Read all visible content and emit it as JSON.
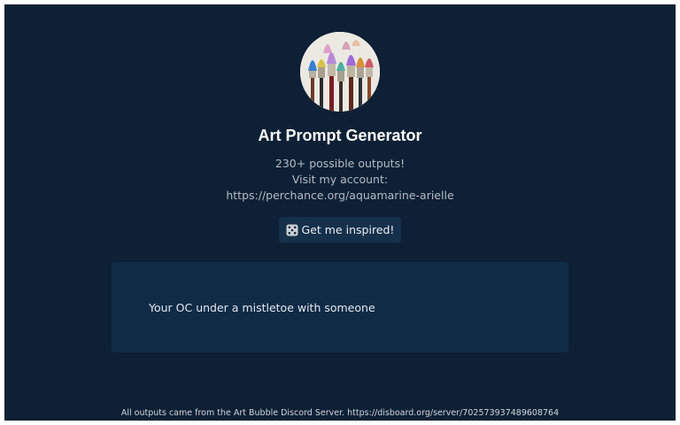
{
  "header": {
    "avatar_icon": "paintbrushes-photo-icon",
    "title": "Art Prompt Generator",
    "description": [
      "230+ possible outputs!",
      "Visit my account:",
      "https://perchance.org/aquamarine-arielle"
    ]
  },
  "inspire_button": {
    "icon": "dice-icon",
    "label": "Get me inspired!"
  },
  "output": {
    "text": "Your OC under a mistletoe with someone"
  },
  "footer": {
    "text": "All outputs came from the Art Bubble Discord Server. https://disboard.org/server/702573937489608764"
  },
  "colors": {
    "background": "#0d2035",
    "card": "#0f2b46",
    "button": "#15304b",
    "title": "#ffffff",
    "muted_text": "#b4bcc6"
  }
}
